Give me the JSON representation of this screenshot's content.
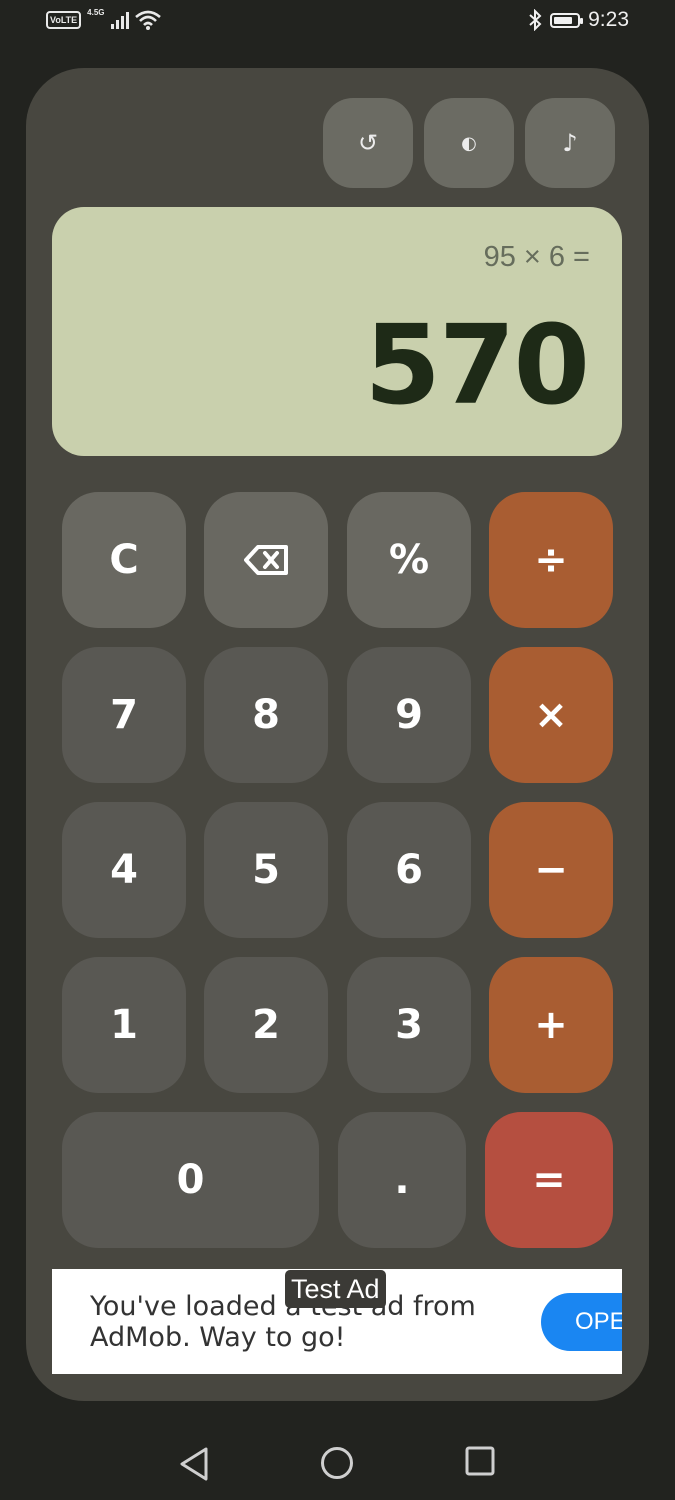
{
  "status_bar": {
    "volte": "VoLTE",
    "network": "4.5G",
    "time": "9:23",
    "icons": [
      "signal-bars-icon",
      "wifi-icon",
      "bluetooth-icon",
      "battery-icon"
    ]
  },
  "toolbar": {
    "buttons": [
      {
        "name": "history",
        "glyph": "↺"
      },
      {
        "name": "theme",
        "glyph": "◐"
      },
      {
        "name": "sound",
        "glyph": "♪"
      }
    ]
  },
  "display": {
    "expression": "95 × 6 =",
    "result": "570"
  },
  "keys": {
    "clear": "C",
    "backspace": "⌫",
    "percent": "%",
    "divide": "÷",
    "seven": "7",
    "eight": "8",
    "nine": "9",
    "multiply": "×",
    "four": "4",
    "five": "5",
    "six": "6",
    "minus": "−",
    "one": "1",
    "two": "2",
    "three": "3",
    "plus": "+",
    "zero": "0",
    "decimal": ".",
    "equals": "="
  },
  "ad": {
    "tag": "Test Ad",
    "text": "You've loaded a test ad from AdMob. Way to go!",
    "button": "OPEN"
  },
  "colors": {
    "background": "#22231f",
    "panel": "#484740",
    "display": "#c9d0ad",
    "operator": "#a95d32",
    "equals": "#b54f40",
    "ad_button": "#1a86f2"
  }
}
